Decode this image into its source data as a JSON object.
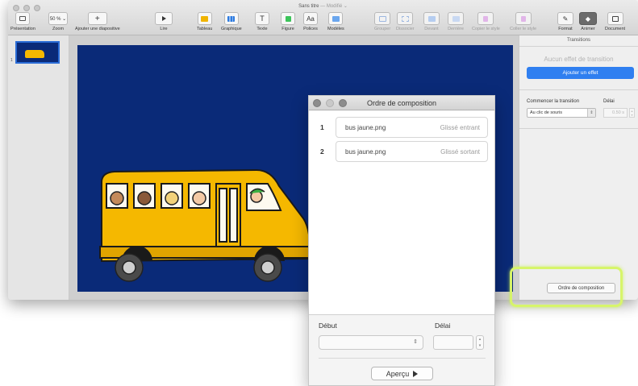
{
  "window": {
    "title": "Sans titre",
    "modified": "— Modifié ⌄"
  },
  "toolbar": {
    "presentation": "Présentation",
    "zoom_value": "50 % ⌄",
    "zoom": "Zoom",
    "add_slide": "Ajouter une diapositive",
    "play": "Lire",
    "table": "Tableau",
    "chart": "Graphique",
    "text": "Texte",
    "shape": "Figure",
    "fonts": "Polices",
    "fonts_glyph": "Aa",
    "themes": "Modèles",
    "group": "Grouper",
    "ungroup": "Dissocier",
    "front": "Devant",
    "back": "Derrière",
    "copy_style": "Copier le style",
    "paste_style": "Coller le style",
    "format": "Format",
    "animate": "Animer",
    "document": "Document"
  },
  "navigator": {
    "slide_number": "1"
  },
  "inspector": {
    "tab": "Transitions",
    "no_effect": "Aucun effet de transition",
    "add_effect": "Ajouter un effet",
    "start_label": "Commencer la transition",
    "delay_label": "Délai",
    "start_value": "Au clic de souris",
    "delay_value": "0.50 s",
    "build_order_button": "Ordre de composition"
  },
  "build_order": {
    "title": "Ordre de composition",
    "items": [
      {
        "num": "1",
        "name": "bus jaune.png",
        "effect": "Glissé entrant"
      },
      {
        "num": "2",
        "name": "bus jaune.png",
        "effect": "Glissé sortant"
      }
    ],
    "start_label": "Début",
    "delay_label": "Délai",
    "preview": "Aperçu"
  },
  "colors": {
    "slide_background": "#0a2a78",
    "accent": "#2f7ff0",
    "bus_yellow": "#f5b800",
    "highlight": "#d7f56a"
  },
  "icons": {
    "presentation": "sidebar-view-icon",
    "add_slide": "plus-icon",
    "play": "play-icon",
    "table": "table-icon",
    "chart": "chart-icon",
    "text": "text-icon",
    "shape": "shape-icon",
    "themes": "themes-icon",
    "format": "paintbrush-icon",
    "animate": "diamond-icon",
    "document": "document-icon"
  }
}
